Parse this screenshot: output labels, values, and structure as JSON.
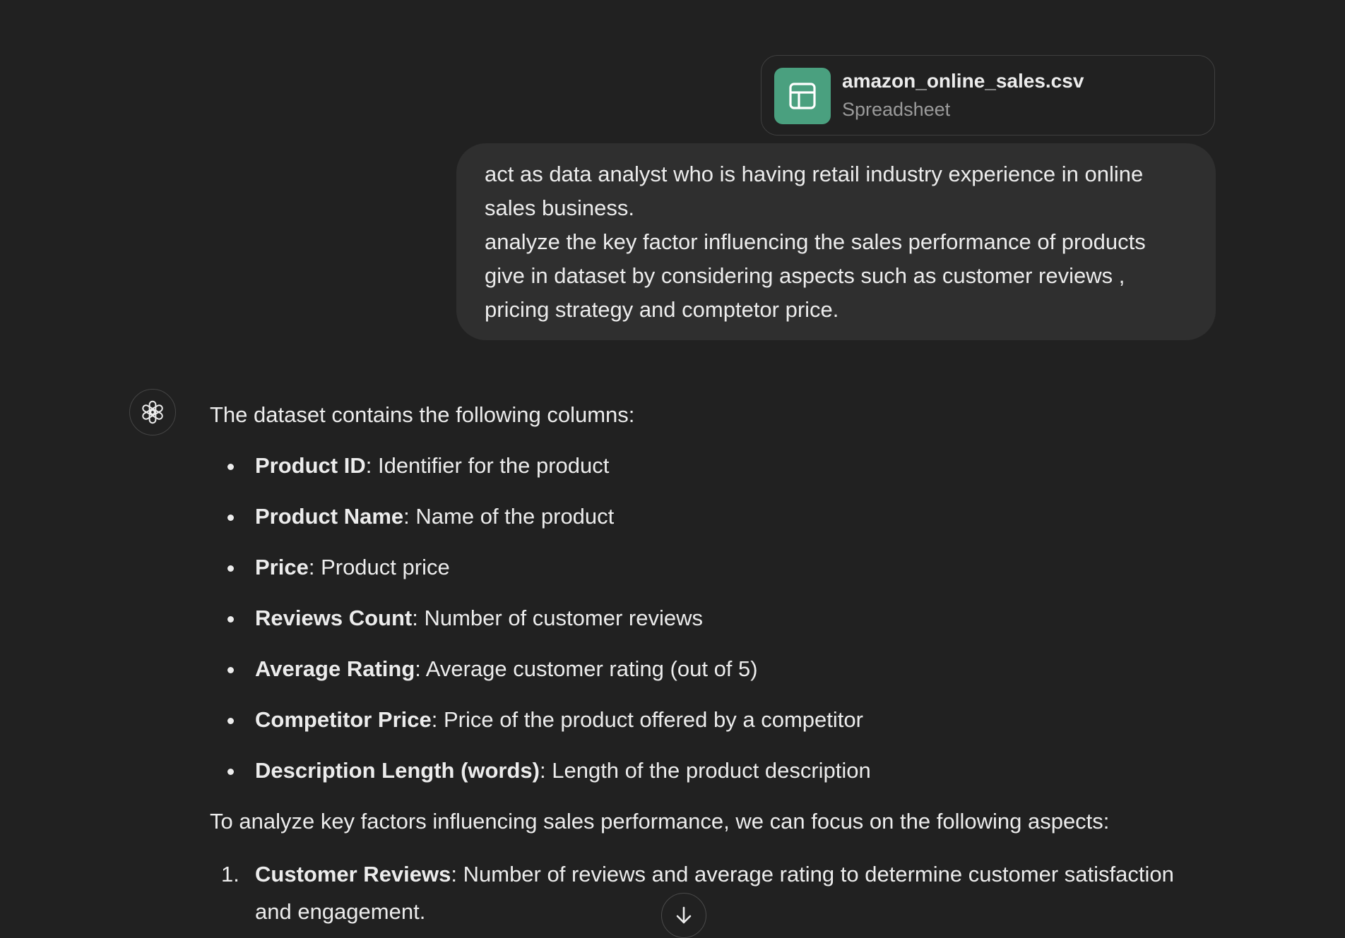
{
  "attachment": {
    "file_name": "amazon_online_sales.csv",
    "file_type": "Spreadsheet",
    "icon": "spreadsheet-icon",
    "icon_color": "#4aa07f"
  },
  "user_message": {
    "paragraphs": [
      "act as data analyst who is having retail industry experience in online sales business.",
      "analyze the key factor influencing the sales performance of products give in dataset by considering aspects such as customer reviews , pricing strategy and comptetor price."
    ]
  },
  "assistant": {
    "avatar_icon": "openai-logo-icon",
    "intro": "The dataset contains the following columns:",
    "columns": [
      {
        "name": "Product ID",
        "desc": ": Identifier for the product"
      },
      {
        "name": "Product Name",
        "desc": ": Name of the product"
      },
      {
        "name": "Price",
        "desc": ": Product price"
      },
      {
        "name": "Reviews Count",
        "desc": ": Number of customer reviews"
      },
      {
        "name": "Average Rating",
        "desc": ": Average customer rating (out of 5)"
      },
      {
        "name": "Competitor Price",
        "desc": ": Price of the product offered by a competitor"
      },
      {
        "name": "Description Length (words)",
        "desc": ": Length of the product description"
      }
    ],
    "aspects_intro": "To analyze key factors influencing sales performance, we can focus on the following aspects:",
    "aspects": [
      {
        "number": "1.",
        "name": "Customer Reviews",
        "desc": ": Number of reviews and average rating to determine customer satisfaction and engagement."
      }
    ]
  },
  "scroll_button": {
    "icon": "arrow-down-icon"
  },
  "colors": {
    "background": "#212121",
    "user_bubble": "#2f2f2f",
    "text": "#ececec",
    "muted_text": "#9b9b9b",
    "accent_green": "#4aa07f"
  }
}
